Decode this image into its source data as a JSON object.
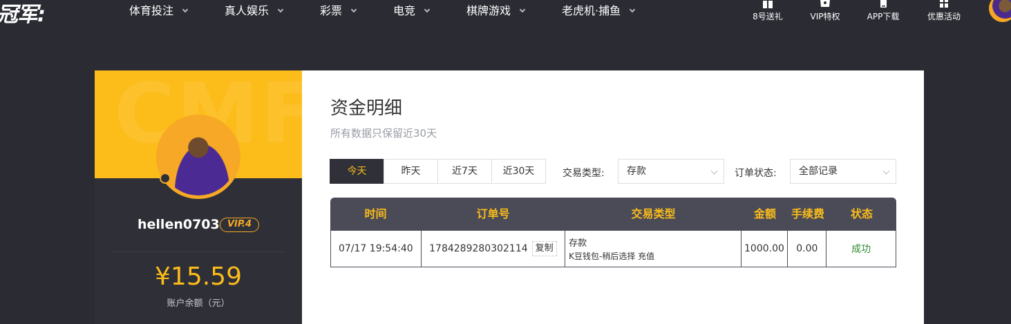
{
  "header": {
    "logo_text": "冠军:",
    "nav": [
      {
        "label": "体育投注"
      },
      {
        "label": "真人娱乐"
      },
      {
        "label": "彩票"
      },
      {
        "label": "电竞"
      },
      {
        "label": "棋牌游戏"
      },
      {
        "label": "老虎机·捕鱼"
      }
    ],
    "right_links": [
      {
        "label": "8号送礼",
        "icon": "gift-icon"
      },
      {
        "label": "VIP特权",
        "icon": "crown-icon"
      },
      {
        "label": "APP下载",
        "icon": "phone-icon"
      },
      {
        "label": "优惠活动",
        "icon": "grid-icon"
      }
    ]
  },
  "sidebar": {
    "banner_text": "CMF",
    "username": "hellen0703",
    "vip_level": "VIP.4",
    "balance": "¥15.59",
    "balance_label": "账户余额（元）"
  },
  "main": {
    "title": "资金明细",
    "subtitle": "所有数据只保留近30天",
    "date_tabs": [
      "今天",
      "昨天",
      "近7天",
      "近30天"
    ],
    "active_tab": "今天",
    "filters": {
      "type_label": "交易类型:",
      "type_value": "存款",
      "status_label": "订单状态:",
      "status_value": "全部记录"
    },
    "table": {
      "headers": [
        "时间",
        "订单号",
        "交易类型",
        "金额",
        "手续费",
        "状态"
      ],
      "rows": [
        {
          "time": "07/17 19:54:40",
          "order_no": "1784289280302114",
          "copy_label": "复制",
          "type_main": "存款",
          "type_sub": "K豆钱包-稍后选择 充值",
          "amount": "1000.00",
          "fee": "0.00",
          "status": "成功"
        }
      ]
    }
  },
  "colors": {
    "accent": "#fcbc1a",
    "page_bg": "#2a2b33",
    "panel_bg": "#2f3037",
    "table_header": "#4a4b57",
    "success": "#2f8a2f"
  }
}
